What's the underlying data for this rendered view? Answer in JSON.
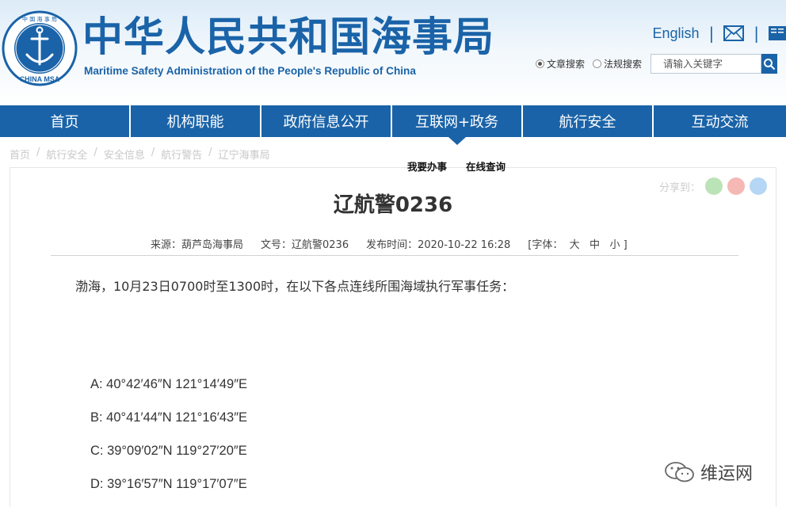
{
  "header": {
    "title": "中华人民共和国海事局",
    "subtitle": "Maritime Safety Administration of the People's Republic of China",
    "logo_ring_text": "中 国 海 事 局",
    "logo_bottom_text": "CHINA MSA",
    "english_link": "English",
    "separator": "|",
    "search": {
      "option_articles": "文章搜索",
      "option_regulations": "法规搜索",
      "selected": "文章搜索",
      "placeholder": "请输入关键字"
    }
  },
  "nav": {
    "items": [
      {
        "label": "首页"
      },
      {
        "label": "机构职能"
      },
      {
        "label": "政府信息公开"
      },
      {
        "label": "互联网+政务"
      },
      {
        "label": "航行安全"
      },
      {
        "label": "互动交流"
      }
    ],
    "active": "互联网+政务",
    "submenu": [
      "我要办事",
      "在线查询"
    ]
  },
  "breadcrumb": [
    "首页",
    "航行安全",
    "安全信息",
    "航行警告",
    "辽宁海事局"
  ],
  "breadcrumb_sep": "/",
  "share": {
    "label": "分享到："
  },
  "article": {
    "title": "辽航警0236",
    "source": "来源：葫芦岛海事局",
    "doc_no": "文号：辽航警0236",
    "publish_time": "发布时间：2020-10-22 16:28",
    "font_size_label": "[字体：",
    "font_large": "大",
    "font_medium": "中",
    "font_small": "小 ]",
    "lead": "渤海，10月23日0700时至1300时，在以下各点连线所围海域执行军事任务：",
    "points": [
      "A: 40°42′46″N 121°14′49″E",
      "B: 40°41′44″N 121°16′43″E",
      "C: 39°09′02″N 119°27′20″E",
      "D: 39°16′57″N 119°17′07″E"
    ]
  },
  "watermark": {
    "text": "维运网"
  },
  "colors": {
    "brand_blue": "#1a63a8",
    "nav_bg": "#1a63a8"
  }
}
